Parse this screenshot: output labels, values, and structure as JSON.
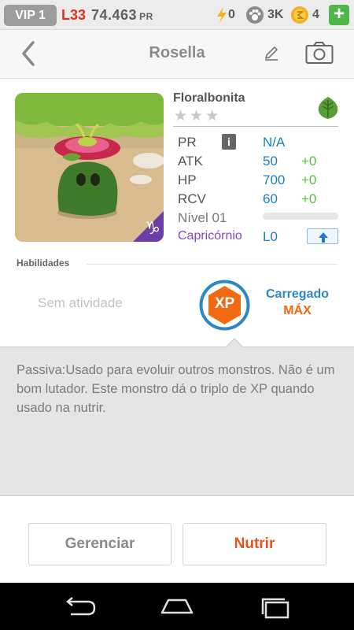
{
  "status_bar": {
    "vip": "VIP 1",
    "level": "L33",
    "pr_value": "74.463",
    "pr_unit": "PR",
    "energy": "0",
    "paw": "3K",
    "coins": "4",
    "plus": "+"
  },
  "header": {
    "title": "Rosella"
  },
  "monster": {
    "name": "Floralbonita",
    "rarity_stars": 3,
    "element_icon": "leaf-icon",
    "stats": {
      "pr_label": "PR",
      "pr_value": "N/A",
      "info": "i",
      "atk_label": "ATK",
      "atk_value": "50",
      "atk_bonus": "+0",
      "hp_label": "HP",
      "hp_value": "700",
      "hp_bonus": "+0",
      "rcv_label": "RCV",
      "rcv_value": "60",
      "rcv_bonus": "+0",
      "level_label": "Nível 01",
      "level_progress": 0
    },
    "sign": "Capricórnio",
    "sign_level": "L0",
    "sign_glyph": "♑"
  },
  "abilities": {
    "title": "Habilidades",
    "empty_text": "Sem atividade",
    "badge": "XP",
    "charged_label": "Carregado",
    "charged_value": "MÁX"
  },
  "description": {
    "text": "Passiva:Usado para evoluir outros monstros. Não é um bom lutador. Este monstro dá o triplo de XP quando usado na nutrir."
  },
  "actions": {
    "manage": "Gerenciar",
    "feed": "Nutrir"
  },
  "colors": {
    "accent_blue": "#1b7fc4",
    "accent_orange": "#f16a11",
    "positive_green": "#5dbb3a",
    "sign_purple": "#8148c8"
  }
}
